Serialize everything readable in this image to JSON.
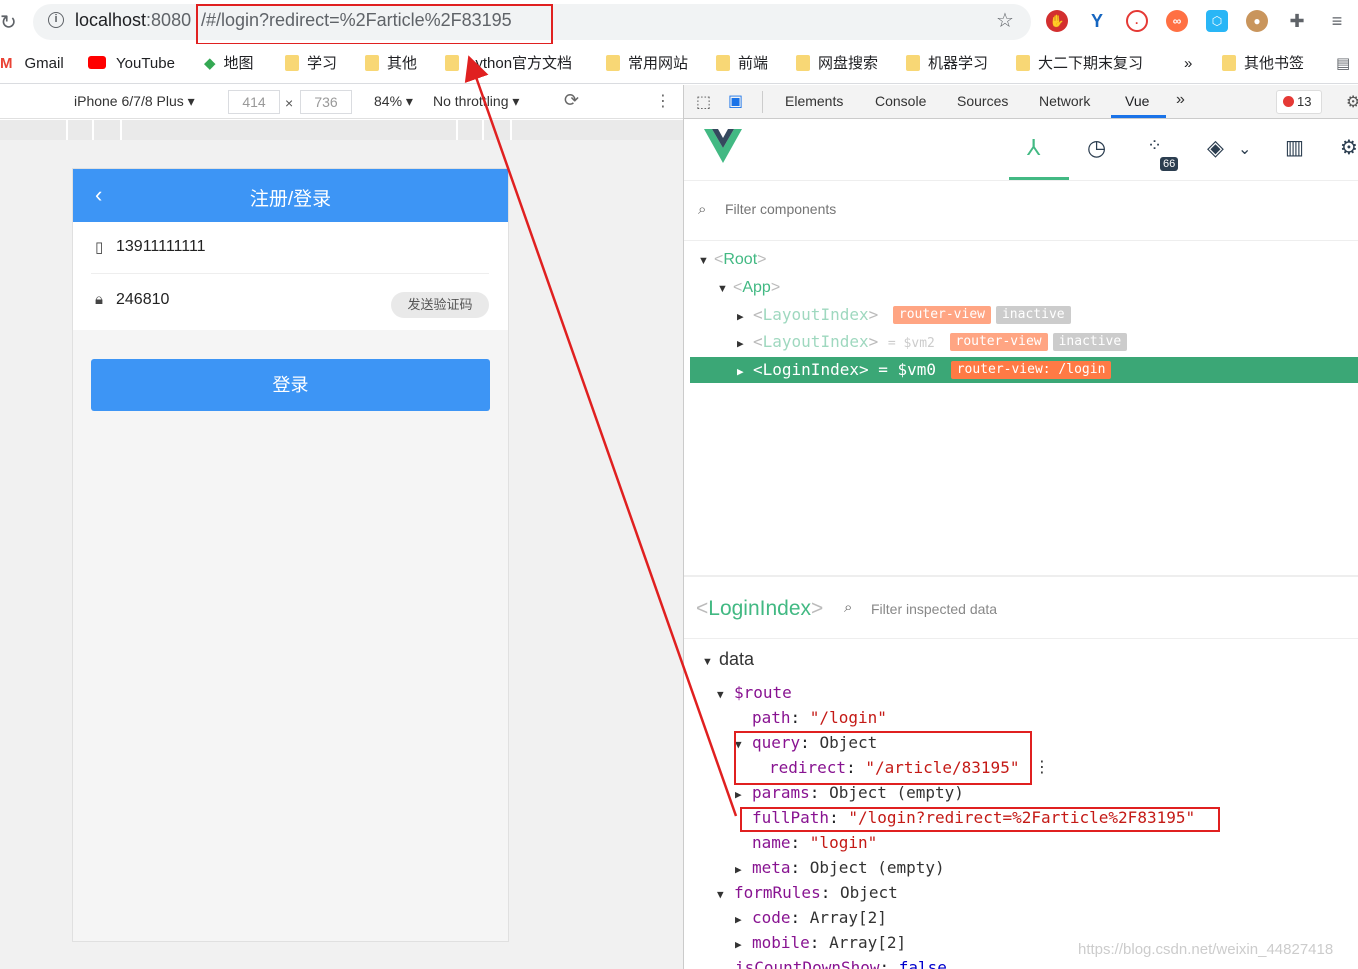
{
  "browser": {
    "url_host": "localhost",
    "url_port": ":8080",
    "url_path": "/#/login?redirect=%2Farticle%2F83195"
  },
  "bookmarks": {
    "items": [
      {
        "label": "Gmail",
        "icon": "gmail-icon"
      },
      {
        "label": "YouTube",
        "icon": "youtube-icon"
      },
      {
        "label": "地图",
        "icon": "maps-icon"
      },
      {
        "label": "学习",
        "icon": "folder-icon"
      },
      {
        "label": "其他",
        "icon": "folder-icon"
      },
      {
        "label": "python官方文档",
        "icon": "folder-icon"
      },
      {
        "label": "常用网站",
        "icon": "folder-icon"
      },
      {
        "label": "前端",
        "icon": "folder-icon"
      },
      {
        "label": "网盘搜索",
        "icon": "folder-icon"
      },
      {
        "label": "机器学习",
        "icon": "folder-icon"
      },
      {
        "label": "大二下期末复习",
        "icon": "folder-icon"
      },
      {
        "label": "其他书签",
        "icon": "folder-icon"
      }
    ],
    "overflow": "»"
  },
  "device_toolbar": {
    "device": "iPhone 6/7/8 Plus",
    "width": "414",
    "times": "×",
    "height": "736",
    "zoom": "84%",
    "throttle": "No throttling"
  },
  "phone_page": {
    "title": "注册/登录",
    "mobile_value": "13911111111",
    "code_value": "246810",
    "send_code_label": "发送验证码",
    "login_label": "登录"
  },
  "devtools": {
    "tabs": [
      "Elements",
      "Console",
      "Sources",
      "Network",
      "Vue"
    ],
    "active_tab": "Vue",
    "error_count": "13"
  },
  "vue": {
    "filter_placeholder": "Filter components",
    "perf_badge": "66",
    "tree": {
      "root": "Root",
      "app": "App",
      "layout1": "LayoutIndex",
      "layout1_badges": [
        "router-view",
        "inactive"
      ],
      "layout2": "LayoutIndex",
      "layout2_vm": "= $vm2",
      "layout2_badges": [
        "router-view",
        "inactive"
      ],
      "login": "LoginIndex",
      "login_vm": "= $vm0",
      "login_badge": "router-view: /login"
    },
    "inspector": {
      "component": "LoginIndex",
      "filter_placeholder": "Filter inspected data",
      "section": "data",
      "rows": [
        {
          "key": "$route",
          "value": ""
        },
        {
          "key": "path",
          "value": "\"/login\""
        },
        {
          "key": "query",
          "value": "Object"
        },
        {
          "key": "redirect",
          "value": "\"/article/83195\""
        },
        {
          "key": "params",
          "value": "Object (empty)"
        },
        {
          "key": "fullPath",
          "value": "\"/login?redirect=%2Farticle%2F83195\""
        },
        {
          "key": "name",
          "value": "\"login\""
        },
        {
          "key": "meta",
          "value": "Object (empty)"
        },
        {
          "key": "formRules",
          "value": "Object"
        },
        {
          "key": "code",
          "value": "Array[2]"
        },
        {
          "key": "mobile",
          "value": "Array[2]"
        },
        {
          "key": "isCountDownShow",
          "value": "false"
        }
      ]
    }
  },
  "watermark": "https://blog.csdn.net/weixin_44827418",
  "colors": {
    "primary_blue": "#3d95f5",
    "vue_green": "#42b983",
    "selected_row": "#3ba776",
    "annotation_red": "#e02020"
  }
}
